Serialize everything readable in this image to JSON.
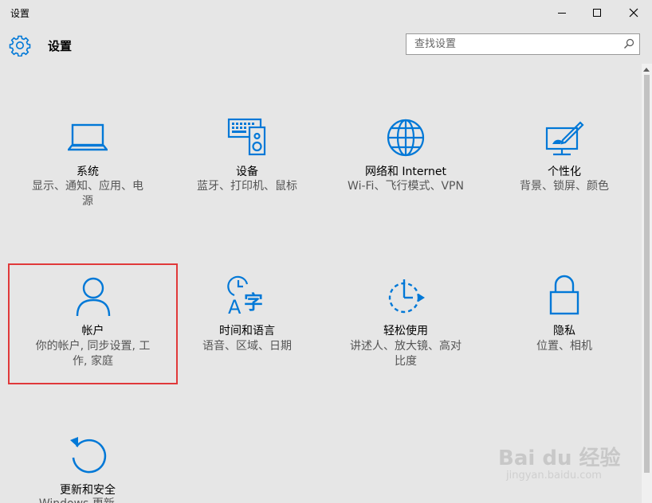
{
  "window": {
    "title": "设置",
    "buttons": [
      "minimize",
      "maximize",
      "close"
    ]
  },
  "header": {
    "title": "设置",
    "search_placeholder": "查找设置"
  },
  "colors": {
    "accent": "#0078d7",
    "selection_border": "#e0393a",
    "background": "#e6e6e6"
  },
  "tiles": [
    {
      "name": "系统",
      "desc1": "显示、通知、应用、电",
      "desc2": "源",
      "icon": "laptop-icon"
    },
    {
      "name": "设备",
      "desc1": "蓝牙、打印机、鼠标",
      "desc2": "",
      "icon": "devices-icon"
    },
    {
      "name": "网络和 Internet",
      "desc1": "Wi-Fi、飞行模式、VPN",
      "desc2": "",
      "icon": "globe-icon"
    },
    {
      "name": "个性化",
      "desc1": "背景、锁屏、颜色",
      "desc2": "",
      "icon": "personalization-icon"
    },
    {
      "name": "帐户",
      "desc1": "你的帐户, 同步设置, 工",
      "desc2": "作, 家庭",
      "icon": "person-icon"
    },
    {
      "name": "时间和语言",
      "desc1": "语音、区域、日期",
      "desc2": "",
      "icon": "time-language-icon"
    },
    {
      "name": "轻松使用",
      "desc1": "讲述人、放大镜、高对",
      "desc2": "比度",
      "icon": "ease-of-access-icon"
    },
    {
      "name": "隐私",
      "desc1": "位置、相机",
      "desc2": "",
      "icon": "lock-icon"
    },
    {
      "name": "更新和安全",
      "desc1": "Windows 更新、...",
      "desc2": "",
      "icon": "update-icon"
    }
  ],
  "watermark": {
    "main": "Bai du 经验",
    "sub": "jingyan.baidu.com"
  }
}
